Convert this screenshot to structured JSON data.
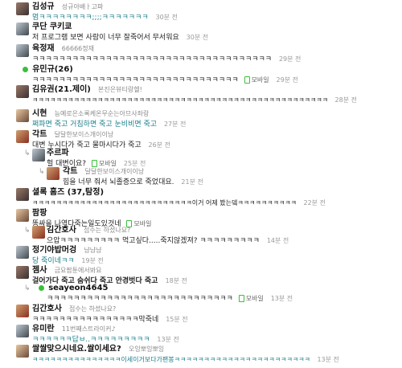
{
  "comments": [
    {
      "nick": "김성규",
      "status": "성규아배ㅏ고파",
      "text": "멈ㅋㅋㅋㅋㅋㅋㅋㅋ;;;;ㅋㅋㅋㅋㅋㅋㅋ",
      "time": "30분 전",
      "mobile": ""
    },
    {
      "nick": "쿠단 쿠키쿄",
      "status": "",
      "text": "저 프로그램 보면 사람이 너무 잘죽어서 무서워요",
      "time": "30분 전",
      "mobile": ""
    },
    {
      "nick": "육정재",
      "status": "66666정재",
      "text": "ㅋㅋㅋㅋㅋㅋㅋㅋㅋㅋㅋㅋㅋㅋㅋㅋㅋㅋㅋㅋㅋㅋㅋㅋㅋㅋㅋㅋㅋㅋㅋㅋㅋㅋㅋㅋ",
      "time": "29분 전",
      "mobile": ""
    },
    {
      "nick": "유민규(26)",
      "status": "",
      "text": "ㅋㅋㅋㅋㅋㅋㅋㅋㅋㅋㅋㅋㅋㅋㅋㅋㅋㅋㅋㅋㅋㅋㅋㅋㅋㅋㅋㅋㅋㅋㅋ",
      "time": "29분 전",
      "mobile": "모바일"
    },
    {
      "nick": "김유권(21.제이)",
      "status": "본진은뷰티랑헬!",
      "text": "ㅋㅋㅋㅋㅋㅋㅋㅋㅋㅋㅋㅋㅋㅋㅋㅋㅋㅋㅋㅋㅋㅋㅋㅋㅋㅋㅋㅋㅋㅋㅋㅋㅋㅋㅋㅋㅋㅋㅋㅋㅋㅋㅋㅋㅋㅋㅋㅋㅋㅋ",
      "time": "28분 전",
      "mobile": ""
    },
    {
      "nick": "시현",
      "status": "능예로은소록케온무순는아므사좌랑",
      "text": "쩌파면 죽고 거침하면 죽고 눈비비면 죽고",
      "time": "27분 전",
      "mobile": ""
    },
    {
      "nick": "각트",
      "status": "달달한보이스개이이낭",
      "text": "대변 누시다가 죽고 물마시다가 죽고",
      "time": "26분 전",
      "mobile": ""
    },
    {
      "nick": "주르파",
      "status": "",
      "text": "헐 대변이요?",
      "time": "25분 전",
      "mobile": "모바일"
    },
    {
      "nick": "각트",
      "status": "달달한보이스개이이낭",
      "text": "힘을 너무 줘서 뇌졸증으로 죽었대요.",
      "time": "21분 전",
      "mobile": ""
    },
    {
      "nick": "셜록 홈즈 (37,탐정)",
      "status": "",
      "text": "ㅋㅋㅋㅋㅋㅋㅋㅋㅋㅋㅋㅋㅋㅋㅋㅋㅋㅋㅋㅋㅋㅋㅋㅋㅋㅋㅋ이거 어제 봤는뎈ㅋㅋㅋㅋㅋㅋㅋㅋㅋㅋ",
      "time": "22분 전",
      "mobile": ""
    },
    {
      "nick": "팜팡",
      "status": "",
      "text": "똥싸을 나역다죽는일도있것네",
      "time": "",
      "mobile": "모바일"
    },
    {
      "nick": "김간호사",
      "status": "접수는 하셨나요?",
      "text": "으압ㅋㅋㅋㅋㅋㅋㅋㅋㅋ 먹고싶다.....죽지않겠져? ㅋㅋㅋㅋㅋㅋㅋㅋㅋ",
      "time": "14분 전",
      "mobile": ""
    },
    {
      "nick": "정기야밥머겅",
      "status": "냠냠냠",
      "text": "당 죽이네ㅋㅋ",
      "time": "19분 전",
      "mobile": ""
    },
    {
      "nick": "젬사",
      "status": "금요팜툰에서봐요",
      "text": "걸어가다 죽고 숨쉬다 죽고 안경벗다 죽고",
      "time": "18분 전",
      "mobile": ""
    },
    {
      "nick": "seayeon4645",
      "status": "",
      "text": "ㅋㅋㅋㅋㅋㅋㅋㅋㅋㅋㅋㅋㅋㅋㅋㅋㅋㅋㅋㅋㅋㅋㅋㅋㅋㅋㅋㅋ",
      "time": "13분 전",
      "mobile": "모바일"
    },
    {
      "nick": "김간호사",
      "status": "접수는 하셨나요?",
      "text": "ㅋㅋㅋㅋㅋㅋㅋㅋㅋㅋㅋㅋㅋㅋㅋㅋ막죽네",
      "time": "15분 전",
      "mobile": ""
    },
    {
      "nick": "유미란",
      "status": "11번째스트라이커♪",
      "text": "ㅋㅋㅋㅋㅋㅋ답ㅂ..ㅋㅋㅋㅋㅋㅋㅋㅋㅋ",
      "time": "13분 전",
      "mobile": ""
    },
    {
      "nick": "쌀쌀맞으시네요.쌀이세요?",
      "status": "오잉뽀잉뽀잉",
      "text": "ㅋㅋㅋㅋㅋㅋㅋㅋㅋㅋㅋㅋㅋㅋㅋ이세이거보다가팬봉ㅋㅋㅋㅋㅋㅋㅋㅋㅋㅋㅋㅋㅋㅋㅋㅋㅋㅋㅋㅋㅋㅋㅋ",
      "time": "13분 전",
      "mobile": ""
    }
  ],
  "colors": {
    "accent_teal": "#1a7d8a",
    "online_dot": "#3bbf3b",
    "meta_gray": "#999999"
  }
}
